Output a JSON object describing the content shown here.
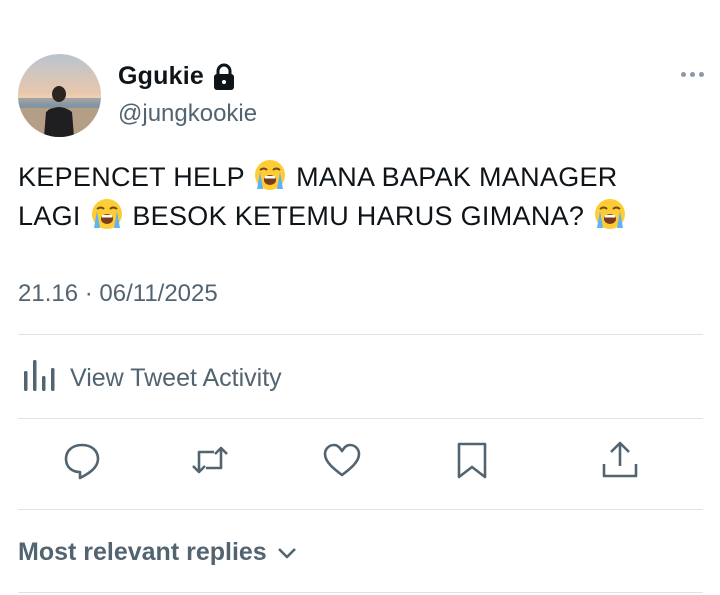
{
  "tweet": {
    "display_name": "Ggukie",
    "handle": "@jungkookie",
    "text_line1_a": "KEPENCET HELP",
    "text_line1_b": "MANA BAPAK MANAGER",
    "text_line2_a": "LAGI",
    "text_line2_b": "BESOK KETEMU HARUS GIMANA?",
    "timestamp": "21.16 · 06/11/2025",
    "emoji_name": "loudly-crying-face"
  },
  "activity": {
    "label": "View Tweet Activity"
  },
  "actions": [
    "reply-icon",
    "retweet-icon",
    "like-icon",
    "bookmark-icon",
    "share-icon"
  ],
  "replies": {
    "label": "Most relevant replies"
  },
  "colors": {
    "text": "#0f1419",
    "secondary": "#536471",
    "divider": "#dfe3e6"
  }
}
